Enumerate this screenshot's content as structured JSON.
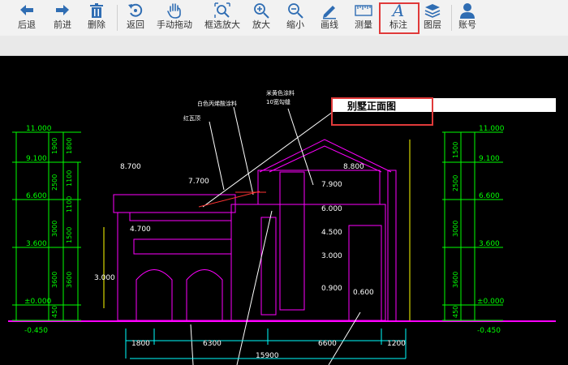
{
  "toolbar": {
    "items": [
      {
        "label": "后退",
        "icon": "back-arrow-icon"
      },
      {
        "label": "前进",
        "icon": "forward-arrow-icon"
      },
      {
        "label": "删除",
        "icon": "trash-icon"
      },
      {
        "label": "返回",
        "icon": "undo-icon"
      },
      {
        "label": "手动拖动",
        "icon": "hand-icon"
      },
      {
        "label": "框选放大",
        "icon": "zoom-window-icon"
      },
      {
        "label": "放大",
        "icon": "zoom-in-icon"
      },
      {
        "label": "缩小",
        "icon": "zoom-out-icon"
      },
      {
        "label": "画线",
        "icon": "pencil-icon"
      },
      {
        "label": "测量",
        "icon": "ruler-icon"
      },
      {
        "label": "标注",
        "icon": "text-annotation-icon"
      },
      {
        "label": "图层",
        "icon": "layers-icon"
      },
      {
        "label": "账号",
        "icon": "user-icon"
      }
    ],
    "active": "标注"
  },
  "drawing": {
    "title": "别墅正面图",
    "annotations": {
      "paint_white": "白色丙烯酸涂料",
      "paint_yellow": "米黄色涂料",
      "tile": "10宽勾缝",
      "roof_tile": "红瓦顶"
    },
    "levels_left": [
      "11.000",
      "9.100",
      "6.600",
      "3.600",
      "±0.000",
      "-0.450"
    ],
    "levels_right": [
      "11.000",
      "9.100",
      "6.600",
      "3.600",
      "±0.000",
      "-0.450"
    ],
    "left_dims_outer": [
      "1900",
      "2500",
      "3000",
      "3600",
      "450"
    ],
    "left_dims_inner": [
      "1800",
      "1100",
      "1100",
      "1500",
      "3600"
    ],
    "right_dims": [
      "1500",
      "2500",
      "3000",
      "3600",
      "450"
    ],
    "elevations_in_plan": [
      "8.700",
      "7.700",
      "8.800",
      "7.900",
      "6.000",
      "4.700",
      "4.500",
      "3.000",
      "3.000",
      "0.900",
      "0.600"
    ],
    "bottom_dims": [
      "1800",
      "6300",
      "6600",
      "1200"
    ],
    "total_width": "15900"
  }
}
